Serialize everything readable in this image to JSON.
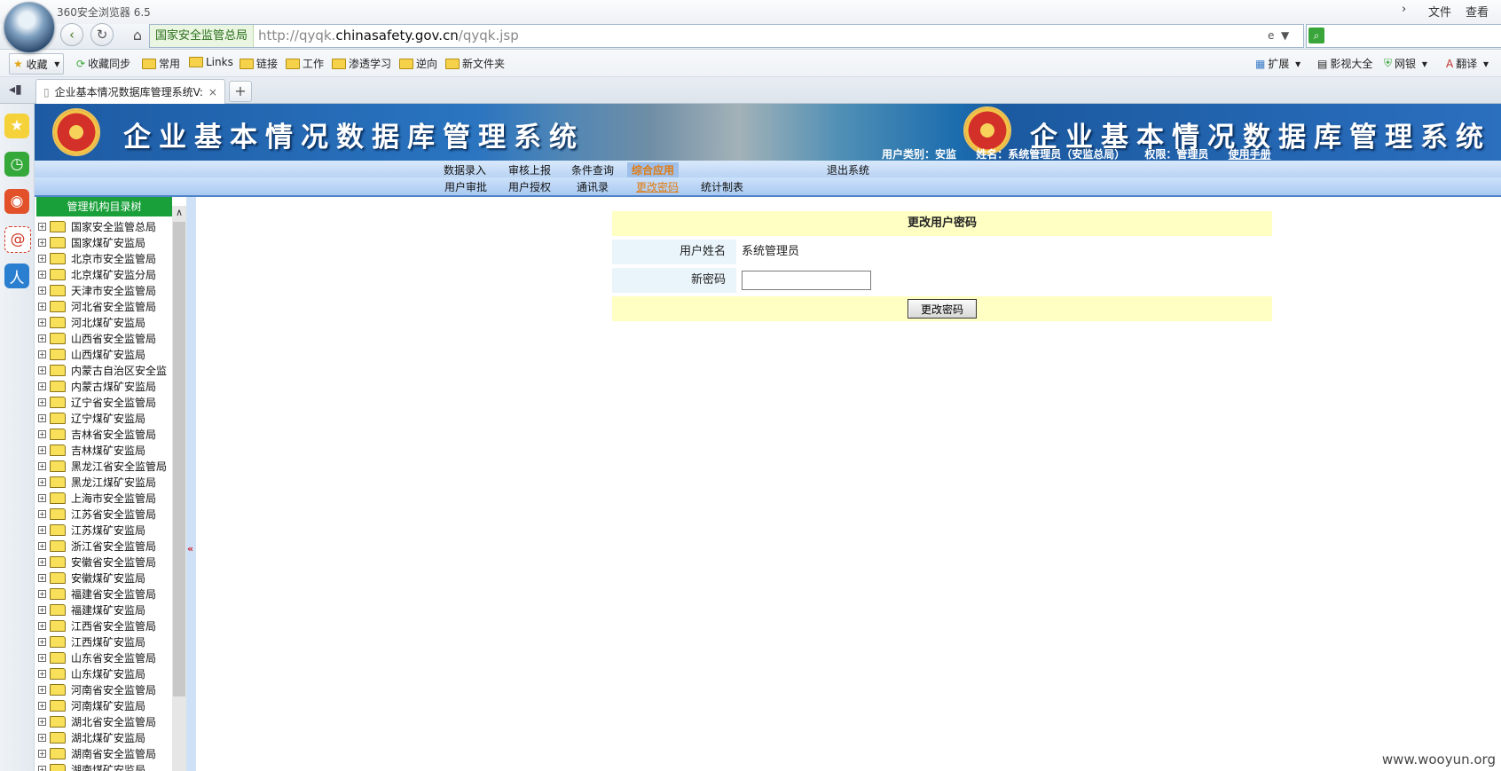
{
  "browser": {
    "app_title": "360安全浏览器 6.5",
    "menu_right": [
      "文件",
      "查看"
    ],
    "site_label": "国家安全监管总局",
    "url_prefix": "http://qyqk.",
    "url_domain": "chinasafety.gov.cn",
    "url_path": "/qyqk.jsp",
    "favorites_button": "收藏",
    "favorites": [
      "收藏同步",
      "常用",
      "Links",
      "链接",
      "工作",
      "渗透学习",
      "逆向",
      "新文件夹"
    ],
    "toolbar_right": [
      "扩展",
      "影视大全",
      "网银",
      "翻译"
    ],
    "tab_title": "企业基本情况数据库管理系统V:"
  },
  "page": {
    "banner_title": "企业基本情况数据库管理系统",
    "user_type": "用户类别：安监",
    "user_name": "姓名：系统管理员（安监总局）",
    "user_role": "权限：管理员",
    "manual_link": "使用手册",
    "menu1": [
      "数据录入",
      "审核上报",
      "条件查询",
      "综合应用",
      "退出系统"
    ],
    "menu2": [
      "用户审批",
      "用户授权",
      "通讯录",
      "更改密码",
      "统计制表"
    ],
    "tree_header": "管理机构目录树",
    "tree_items": [
      "国家安全监管总局",
      "国家煤矿安监局",
      "北京市安全监管局",
      "北京煤矿安监分局",
      "天津市安全监管局",
      "河北省安全监管局",
      "河北煤矿安监局",
      "山西省安全监管局",
      "山西煤矿安监局",
      "内蒙古自治区安全监",
      "内蒙古煤矿安监局",
      "辽宁省安全监管局",
      "辽宁煤矿安监局",
      "吉林省安全监管局",
      "吉林煤矿安监局",
      "黑龙江省安全监管局",
      "黑龙江煤矿安监局",
      "上海市安全监管局",
      "江苏省安全监管局",
      "江苏煤矿安监局",
      "浙江省安全监管局",
      "安徽省安全监管局",
      "安徽煤矿安监局",
      "福建省安全监管局",
      "福建煤矿安监局",
      "江西省安全监管局",
      "江西煤矿安监局",
      "山东省安全监管局",
      "山东煤矿安监局",
      "河南省安全监管局",
      "河南煤矿安监局",
      "湖北省安全监管局",
      "湖北煤矿安监局",
      "湖南省安全监管局",
      "湖南煤矿安监局"
    ],
    "form": {
      "title": "更改用户密码",
      "username_label": "用户姓名",
      "username_value": "系统管理员",
      "new_password_label": "新密码",
      "new_password_value": "",
      "submit_label": "更改密码"
    },
    "watermark": "www.wooyun.org"
  }
}
